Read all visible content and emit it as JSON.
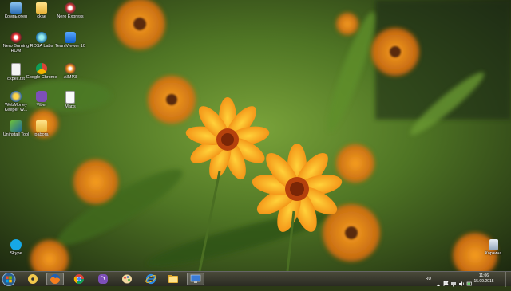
{
  "desktop": {
    "icons": [
      {
        "label": "Компьютер",
        "icon": "computer-icon"
      },
      {
        "label": "ckae",
        "icon": "folder-icon"
      },
      {
        "label": "Nero Express",
        "icon": "nero-express-icon"
      },
      {
        "label": "Nero Burning ROM",
        "icon": "nero-burning-rom-icon"
      },
      {
        "label": "ROSA Labs",
        "icon": "rosa-icon"
      },
      {
        "label": "TeamViewer 10",
        "icon": "teamviewer-icon"
      },
      {
        "label": "ckpec.txt",
        "icon": "text-file-icon"
      },
      {
        "label": "Google Chrome",
        "icon": "chrome-icon"
      },
      {
        "label": "AIMP3",
        "icon": "aimp-icon"
      },
      {
        "label": "WebMoney Keeper W...",
        "icon": "webmoney-icon"
      },
      {
        "label": "Viber",
        "icon": "viber-icon"
      },
      {
        "label": "Maps",
        "icon": "document-icon"
      },
      {
        "label": "Uninstall Tool",
        "icon": "uninstall-tool-icon"
      },
      {
        "label": "pabora",
        "icon": "folder-icon"
      },
      {
        "label": "Skype",
        "icon": "skype-icon"
      },
      {
        "label": "Корзина",
        "icon": "recycle-bin-icon"
      }
    ]
  },
  "taskbar": {
    "apps": [
      {
        "name": "cd-icon"
      },
      {
        "name": "firefox-icon",
        "active": true
      },
      {
        "name": "chrome-icon"
      },
      {
        "name": "viber-icon"
      },
      {
        "name": "paint-icon"
      },
      {
        "name": "internet-explorer-icon"
      },
      {
        "name": "explorer-folder-icon"
      },
      {
        "name": "remote-desktop-icon",
        "active": true
      }
    ],
    "tray": {
      "language": "RU",
      "time": "11:06",
      "date": "15.09.2015"
    }
  },
  "colors": {
    "accent": "#f5a623",
    "taskbar": "#3a3a2e"
  }
}
